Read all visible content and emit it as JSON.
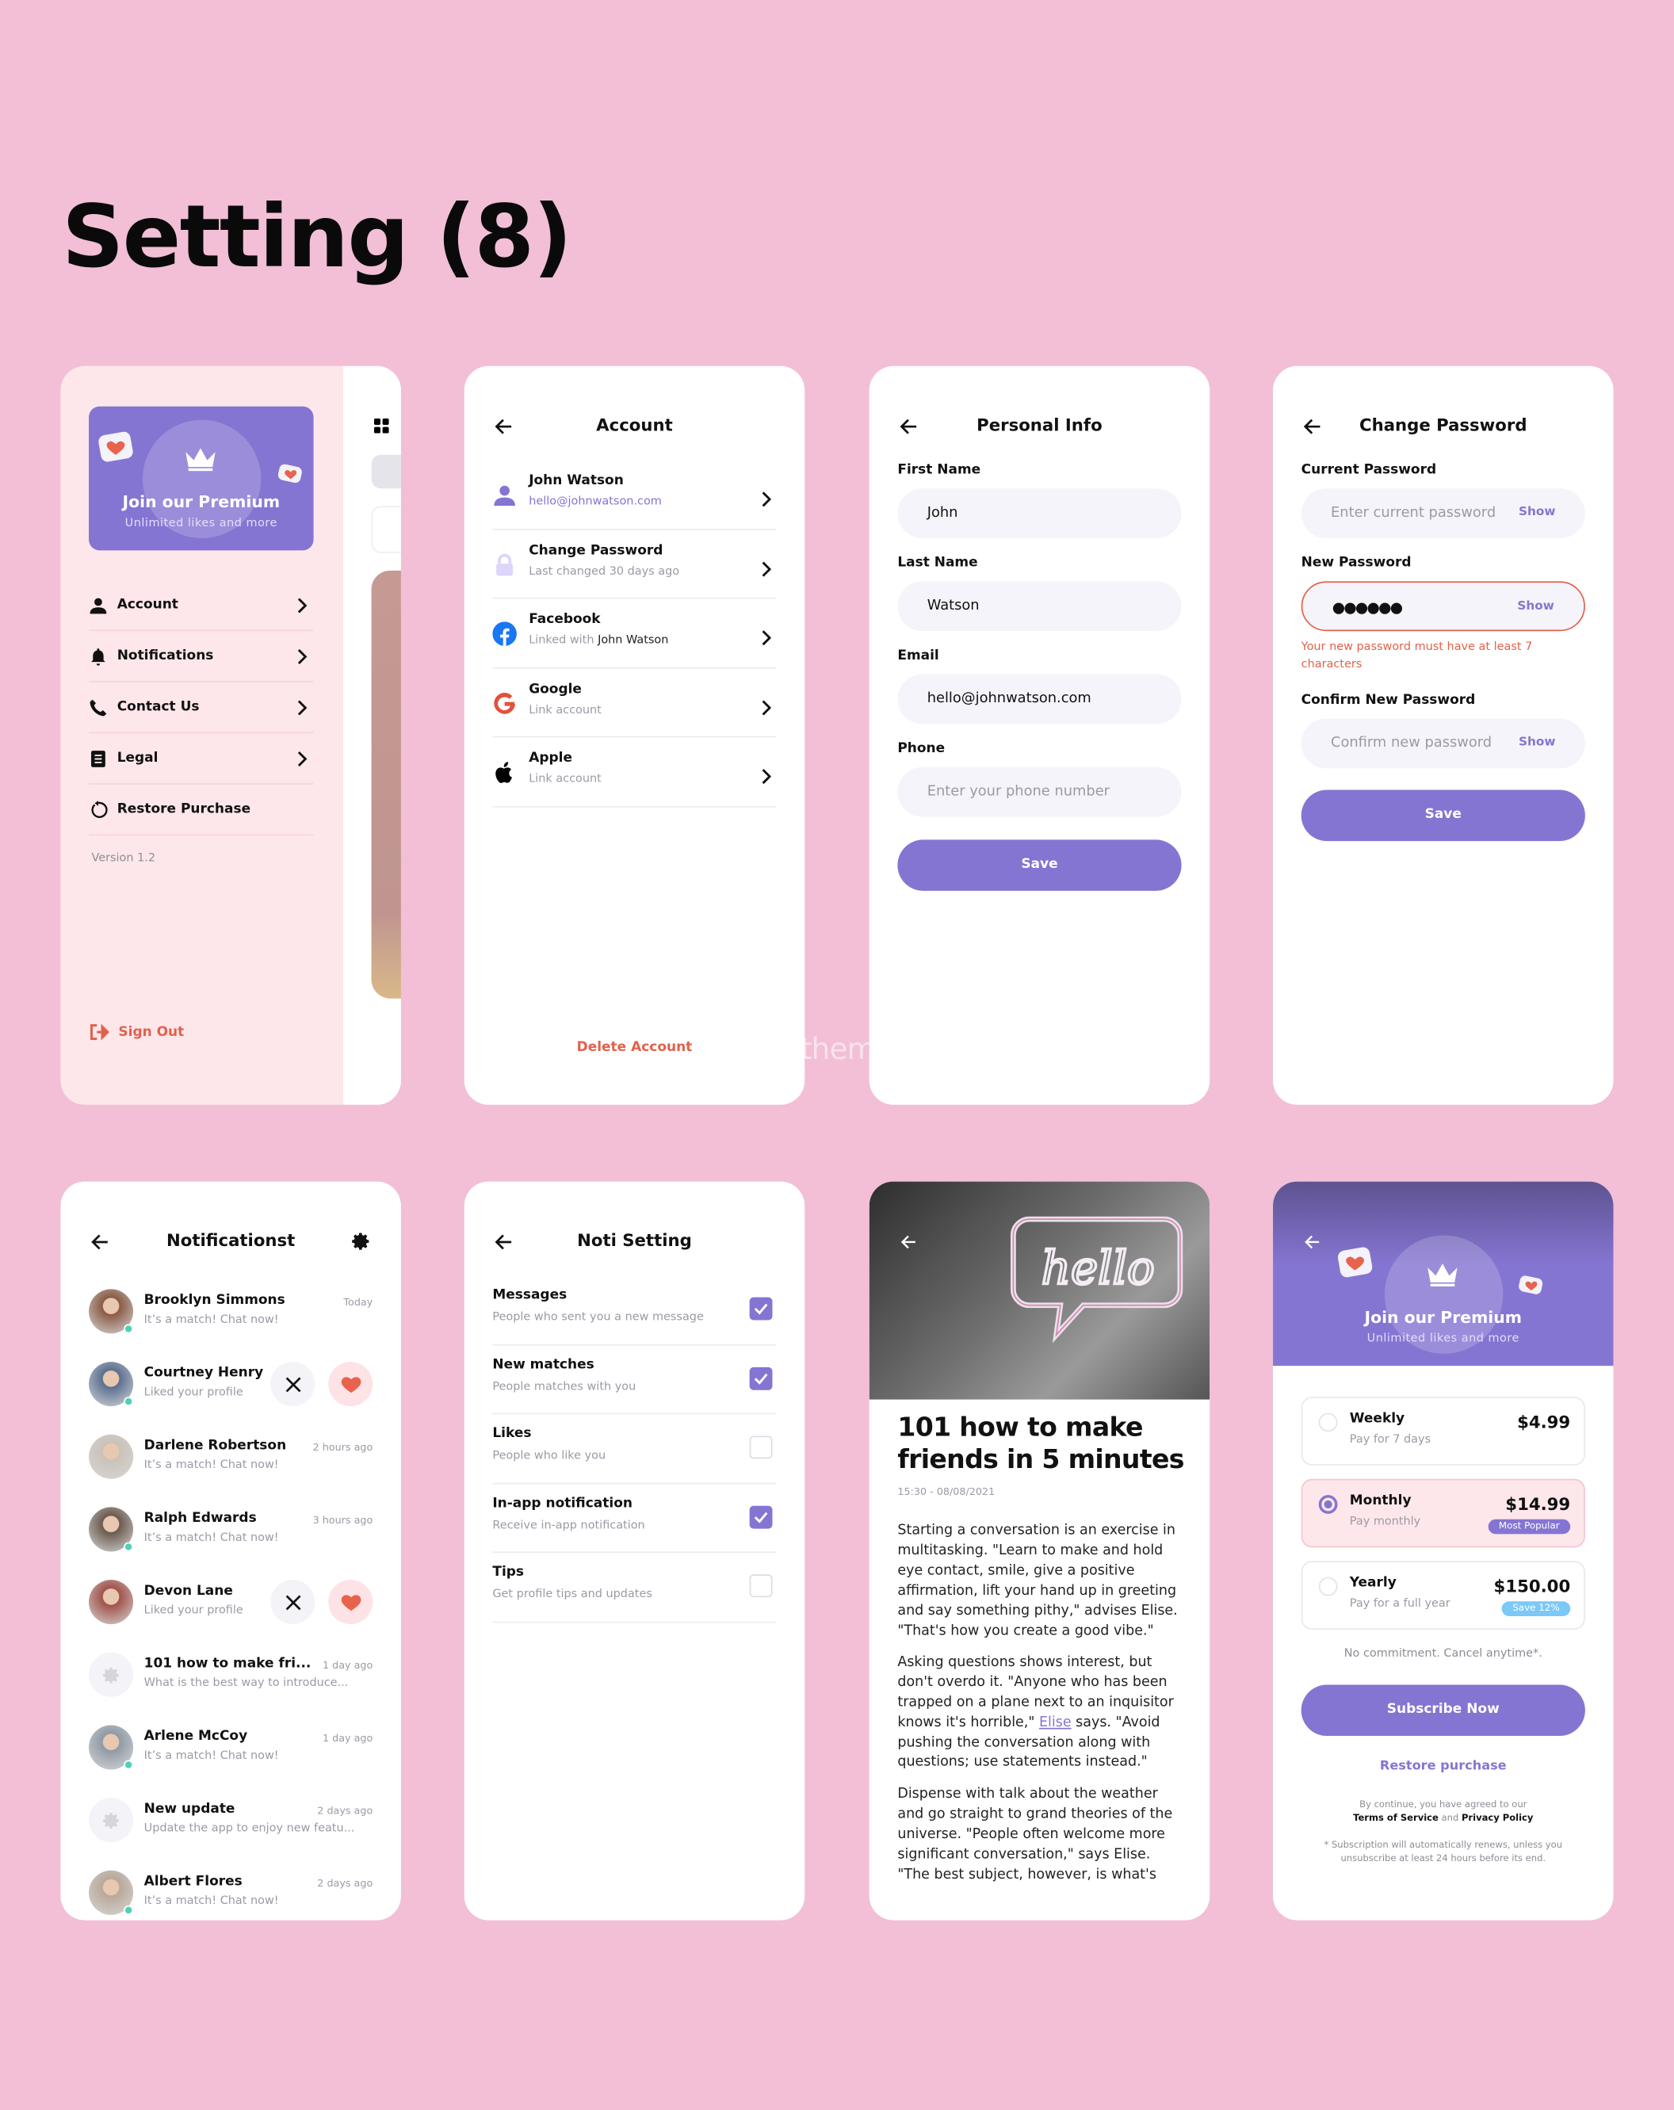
{
  "page_title": "Setting (8)",
  "watermark": "goodtheme.com",
  "colors": {
    "accent": "#8575d2",
    "danger": "#e2614c",
    "online": "#4fd1b8",
    "background": "#f2bfd6",
    "drawer": "#fde7ea"
  },
  "menu": {
    "premium": {
      "title": "Join our Premium",
      "subtitle": "Unlimited likes and more",
      "icon": "crown-icon"
    },
    "items": [
      {
        "label": "Account",
        "icon": "user-icon",
        "chevron": true
      },
      {
        "label": "Notifications",
        "icon": "bell-icon",
        "chevron": true
      },
      {
        "label": "Contact Us",
        "icon": "phone-icon",
        "chevron": true
      },
      {
        "label": "Legal",
        "icon": "document-icon",
        "chevron": true
      },
      {
        "label": "Restore Purchase",
        "icon": "restore-icon",
        "chevron": false
      }
    ],
    "version": "Version 1.2",
    "sign_out": "Sign Out"
  },
  "account": {
    "title": "Account",
    "rows": [
      {
        "title": "John Watson",
        "subtitle": "hello@johnwatson.com",
        "icon": "user-icon"
      },
      {
        "title": "Change Password",
        "subtitle": "Last changed 30 days ago",
        "icon": "lock-icon"
      },
      {
        "title": "Facebook",
        "subtitle": "Linked with",
        "subtitle_strong": "John Watson",
        "icon": "facebook-icon"
      },
      {
        "title": "Google",
        "subtitle": "Link account",
        "icon": "google-icon"
      },
      {
        "title": "Apple",
        "subtitle": "Link account",
        "icon": "apple-icon"
      }
    ],
    "delete": "Delete Account"
  },
  "personal": {
    "title": "Personal Info",
    "fields": [
      {
        "label": "First Name",
        "value": "John",
        "placeholder": ""
      },
      {
        "label": "Last Name",
        "value": "Watson",
        "placeholder": ""
      },
      {
        "label": "Email",
        "value": "hello@johnwatson.com",
        "placeholder": ""
      },
      {
        "label": "Phone",
        "value": "",
        "placeholder": "Enter your phone number"
      }
    ],
    "save": "Save"
  },
  "password": {
    "title": "Change Password",
    "current_label": "Current Password",
    "current_placeholder": "Enter current password",
    "new_label": "New Password",
    "new_value": "●●●●●●",
    "error": "Your new password must have at least 7 characters",
    "confirm_label": "Confirm New Password",
    "confirm_placeholder": "Confirm new password",
    "show": "Show",
    "save": "Save"
  },
  "notifications": {
    "title": "Notificationst",
    "items": [
      {
        "name": "Brooklyn Simmons",
        "text": "It’s a match! Chat now!",
        "time": "Today",
        "type": "avatar",
        "online": true,
        "color": "#8a5a44"
      },
      {
        "name": "Courtney Henry",
        "text": "Liked your profile",
        "time": "",
        "type": "like",
        "online": true,
        "color": "#5a6f90"
      },
      {
        "name": "Darlene Robertson",
        "text": "It’s a match! Chat now!",
        "time": "2 hours ago",
        "type": "avatar",
        "online": false,
        "color": "#c9c2b8"
      },
      {
        "name": "Ralph Edwards",
        "text": "It’s a match! Chat now!",
        "time": "3 hours ago",
        "type": "avatar",
        "online": true,
        "color": "#6b5a4e"
      },
      {
        "name": "Devon Lane",
        "text": "Liked your profile",
        "time": "",
        "type": "like",
        "online": false,
        "color": "#a0524a"
      },
      {
        "name": "101 how to make fri...",
        "text": "What is the best way to introduce...",
        "time": "1 day ago",
        "type": "system",
        "online": false,
        "color": "#f3f3f8"
      },
      {
        "name": "Arlene McCoy",
        "text": "It’s a match! Chat now!",
        "time": "1 day ago",
        "type": "avatar",
        "online": true,
        "color": "#8f9aa5"
      },
      {
        "name": "New update",
        "text": "Update the app to enjoy new featu...",
        "time": "2 days ago",
        "type": "system",
        "online": false,
        "color": "#f3f3f8"
      },
      {
        "name": "Albert Flores",
        "text": "It’s a match! Chat now!",
        "time": "2 days ago",
        "type": "avatar",
        "online": true,
        "color": "#b8a898"
      }
    ]
  },
  "noti_setting": {
    "title": "Noti Setting",
    "items": [
      {
        "title": "Messages",
        "subtitle": "People who sent you a new message",
        "checked": true
      },
      {
        "title": "New matches",
        "subtitle": "People matches with you",
        "checked": true
      },
      {
        "title": "Likes",
        "subtitle": "People who like you",
        "checked": false
      },
      {
        "title": "In-app notification",
        "subtitle": "Receive in-app notification",
        "checked": true
      },
      {
        "title": "Tips",
        "subtitle": "Get profile tips and updates",
        "checked": false
      }
    ]
  },
  "article": {
    "image_sign": "hello",
    "title": "101 how to make friends in 5 minutes",
    "date": "15:30 - 08/08/2021",
    "p1": "Starting a conversation is an exercise in multitasking. \"Learn to make and hold eye contact, smile, give a positive affirmation, lift your hand up in greeting and say something pithy,\" advises Elise. \"That's how you create a good vibe.\"",
    "p2_a": "Asking questions shows interest, but don't overdo it. \"Anyone who has been trapped on a plane next to an inquisitor knows it's horrible,\" ",
    "p2_link": "Elise",
    "p2_b": " says. \"Avoid pushing the conversation along with questions; use statements instead.\"",
    "p3": "Dispense with talk about the weather and go straight to grand theories of the universe. \"People often welcome more significant conversation,\" says Elise. \"The best subject, however, is what's"
  },
  "subscription": {
    "title": "Join our Premium",
    "subtitle": "Unlimited likes and more",
    "plans": [
      {
        "name": "Weekly",
        "desc": "Pay for 7 days",
        "price": "$4.99",
        "badge": "",
        "selected": false
      },
      {
        "name": "Monthly",
        "desc": "Pay monthly",
        "price": "$14.99",
        "badge": "Most Popular",
        "badge_color": "#8575d2",
        "selected": true
      },
      {
        "name": "Yearly",
        "desc": "Pay for a full year",
        "price": "$150.00",
        "badge": "Save 12%",
        "badge_color": "#7cc8f8",
        "selected": false
      }
    ],
    "note": "No commitment. Cancel anytime*.",
    "subscribe": "Subscribe Now",
    "restore": "Restore purchase",
    "terms_prefix": "By continue, you have agreed to our",
    "terms": "Terms of Service",
    "and": "and",
    "privacy": "Privacy Policy",
    "footnote": "* Subscription will automatically renews, unless you unsubscribe at least 24 hours before its end."
  }
}
